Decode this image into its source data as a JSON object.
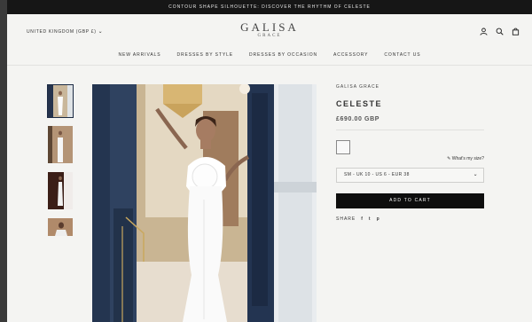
{
  "announcement": "CONTOUR SHAPE SILHOUETTE: DISCOVER THE RHYTHM OF CELESTE",
  "header": {
    "country": "UNITED KINGDOM (GBP £)",
    "logo_main": "GALISA",
    "logo_sub": "GRACE"
  },
  "nav": [
    "NEW ARRIVALS",
    "DRESSES BY STYLE",
    "DRESSES BY OCCASION",
    "ACCESSORY",
    "CONTACT US"
  ],
  "product": {
    "brand": "GALISA GRACE",
    "title": "CELESTE",
    "price": "£690.00 GBP",
    "size_cart_label": "What's my size?",
    "size_selected": "SM - UK 10 - US 6 - EUR 38",
    "add_to_cart": "ADD TO CART",
    "share_label": "SHARE",
    "share_icons": [
      "f",
      "t",
      "p"
    ]
  },
  "colors": {
    "accent_navy": "#1c2b44",
    "button_black": "#0e0e0e"
  }
}
